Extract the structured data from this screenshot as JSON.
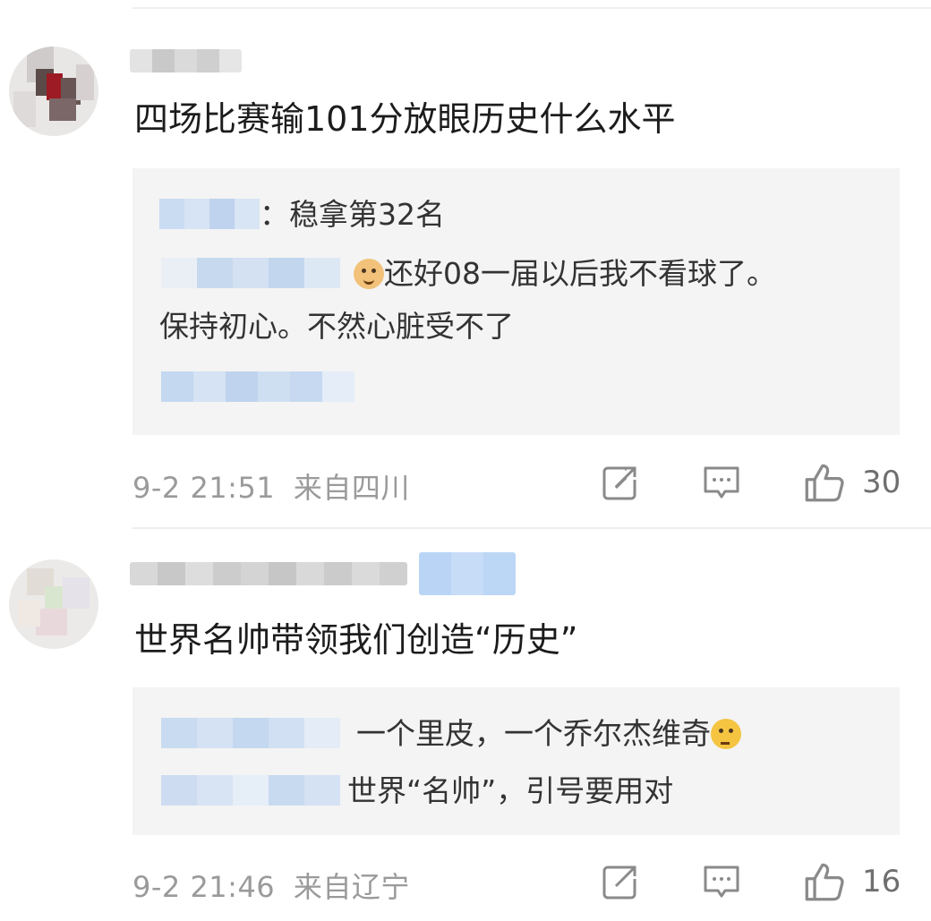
{
  "comments": [
    {
      "text": "四场比赛输101分放眼历史什么水平",
      "replies": [
        {
          "suffix": "：稳拿第32名"
        },
        {
          "suffix": "还好08一届以后我不看球了。",
          "emoji": "doge-emoji",
          "continuation": "保持初心。不然心脏受不了"
        }
      ],
      "timestamp": "9-2 21:51",
      "location": "来自四川",
      "likes": "30"
    },
    {
      "text": "世界名帅带领我们创造“历史”",
      "replies": [
        {
          "suffix": "一个里皮，一个乔尔杰维奇",
          "emoji": "thinking-emoji"
        },
        {
          "suffix": "世界“名帅”，引号要用对"
        }
      ],
      "timestamp": "9-2 21:46",
      "location": "来自辽宁",
      "likes": "16"
    }
  ],
  "icons": {
    "repost": "repost-icon",
    "comment": "comment-icon",
    "like": "thumbs-up-icon"
  },
  "colors": {
    "reply_bg": "#f4f4f4",
    "meta_text": "#9a9a9a",
    "link_blur": "#c9dcf2"
  }
}
